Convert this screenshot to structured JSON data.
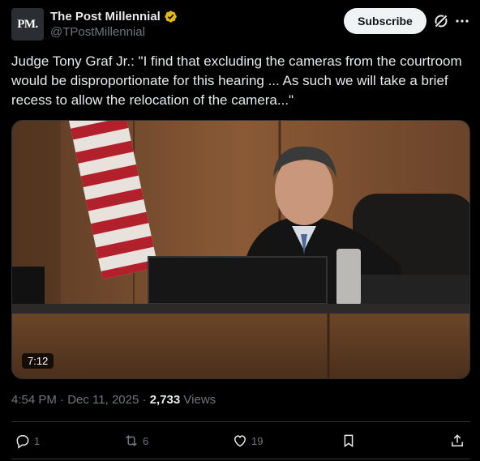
{
  "account": {
    "avatar_text": "PM.",
    "display_name": "The Post Millennial",
    "handle": "@TPostMillennial",
    "verified_icon": "verified-badge-gold-icon"
  },
  "header": {
    "subscribe_label": "Subscribe",
    "grok_icon": "grok-icon",
    "more_icon": "more-icon"
  },
  "tweet": {
    "text": "Judge Tony Graf Jr.: \"I find that excluding the cameras from the courtroom would be disproportionate for this hearing ... As such we will take a brief recess to allow the relocation of the camera...\""
  },
  "media": {
    "duration": "7:12"
  },
  "meta": {
    "time": "4:54 PM",
    "date": "Dec 11, 2025",
    "views_count": "2,733",
    "views_label": "Views"
  },
  "actions": {
    "replies": "1",
    "reposts": "6",
    "likes": "19"
  },
  "colors": {
    "background": "#000000",
    "text": "#e7e9ea",
    "muted": "#71767b",
    "verified_gold": "#e2b719",
    "subscribe_bg": "#eff3f4"
  }
}
